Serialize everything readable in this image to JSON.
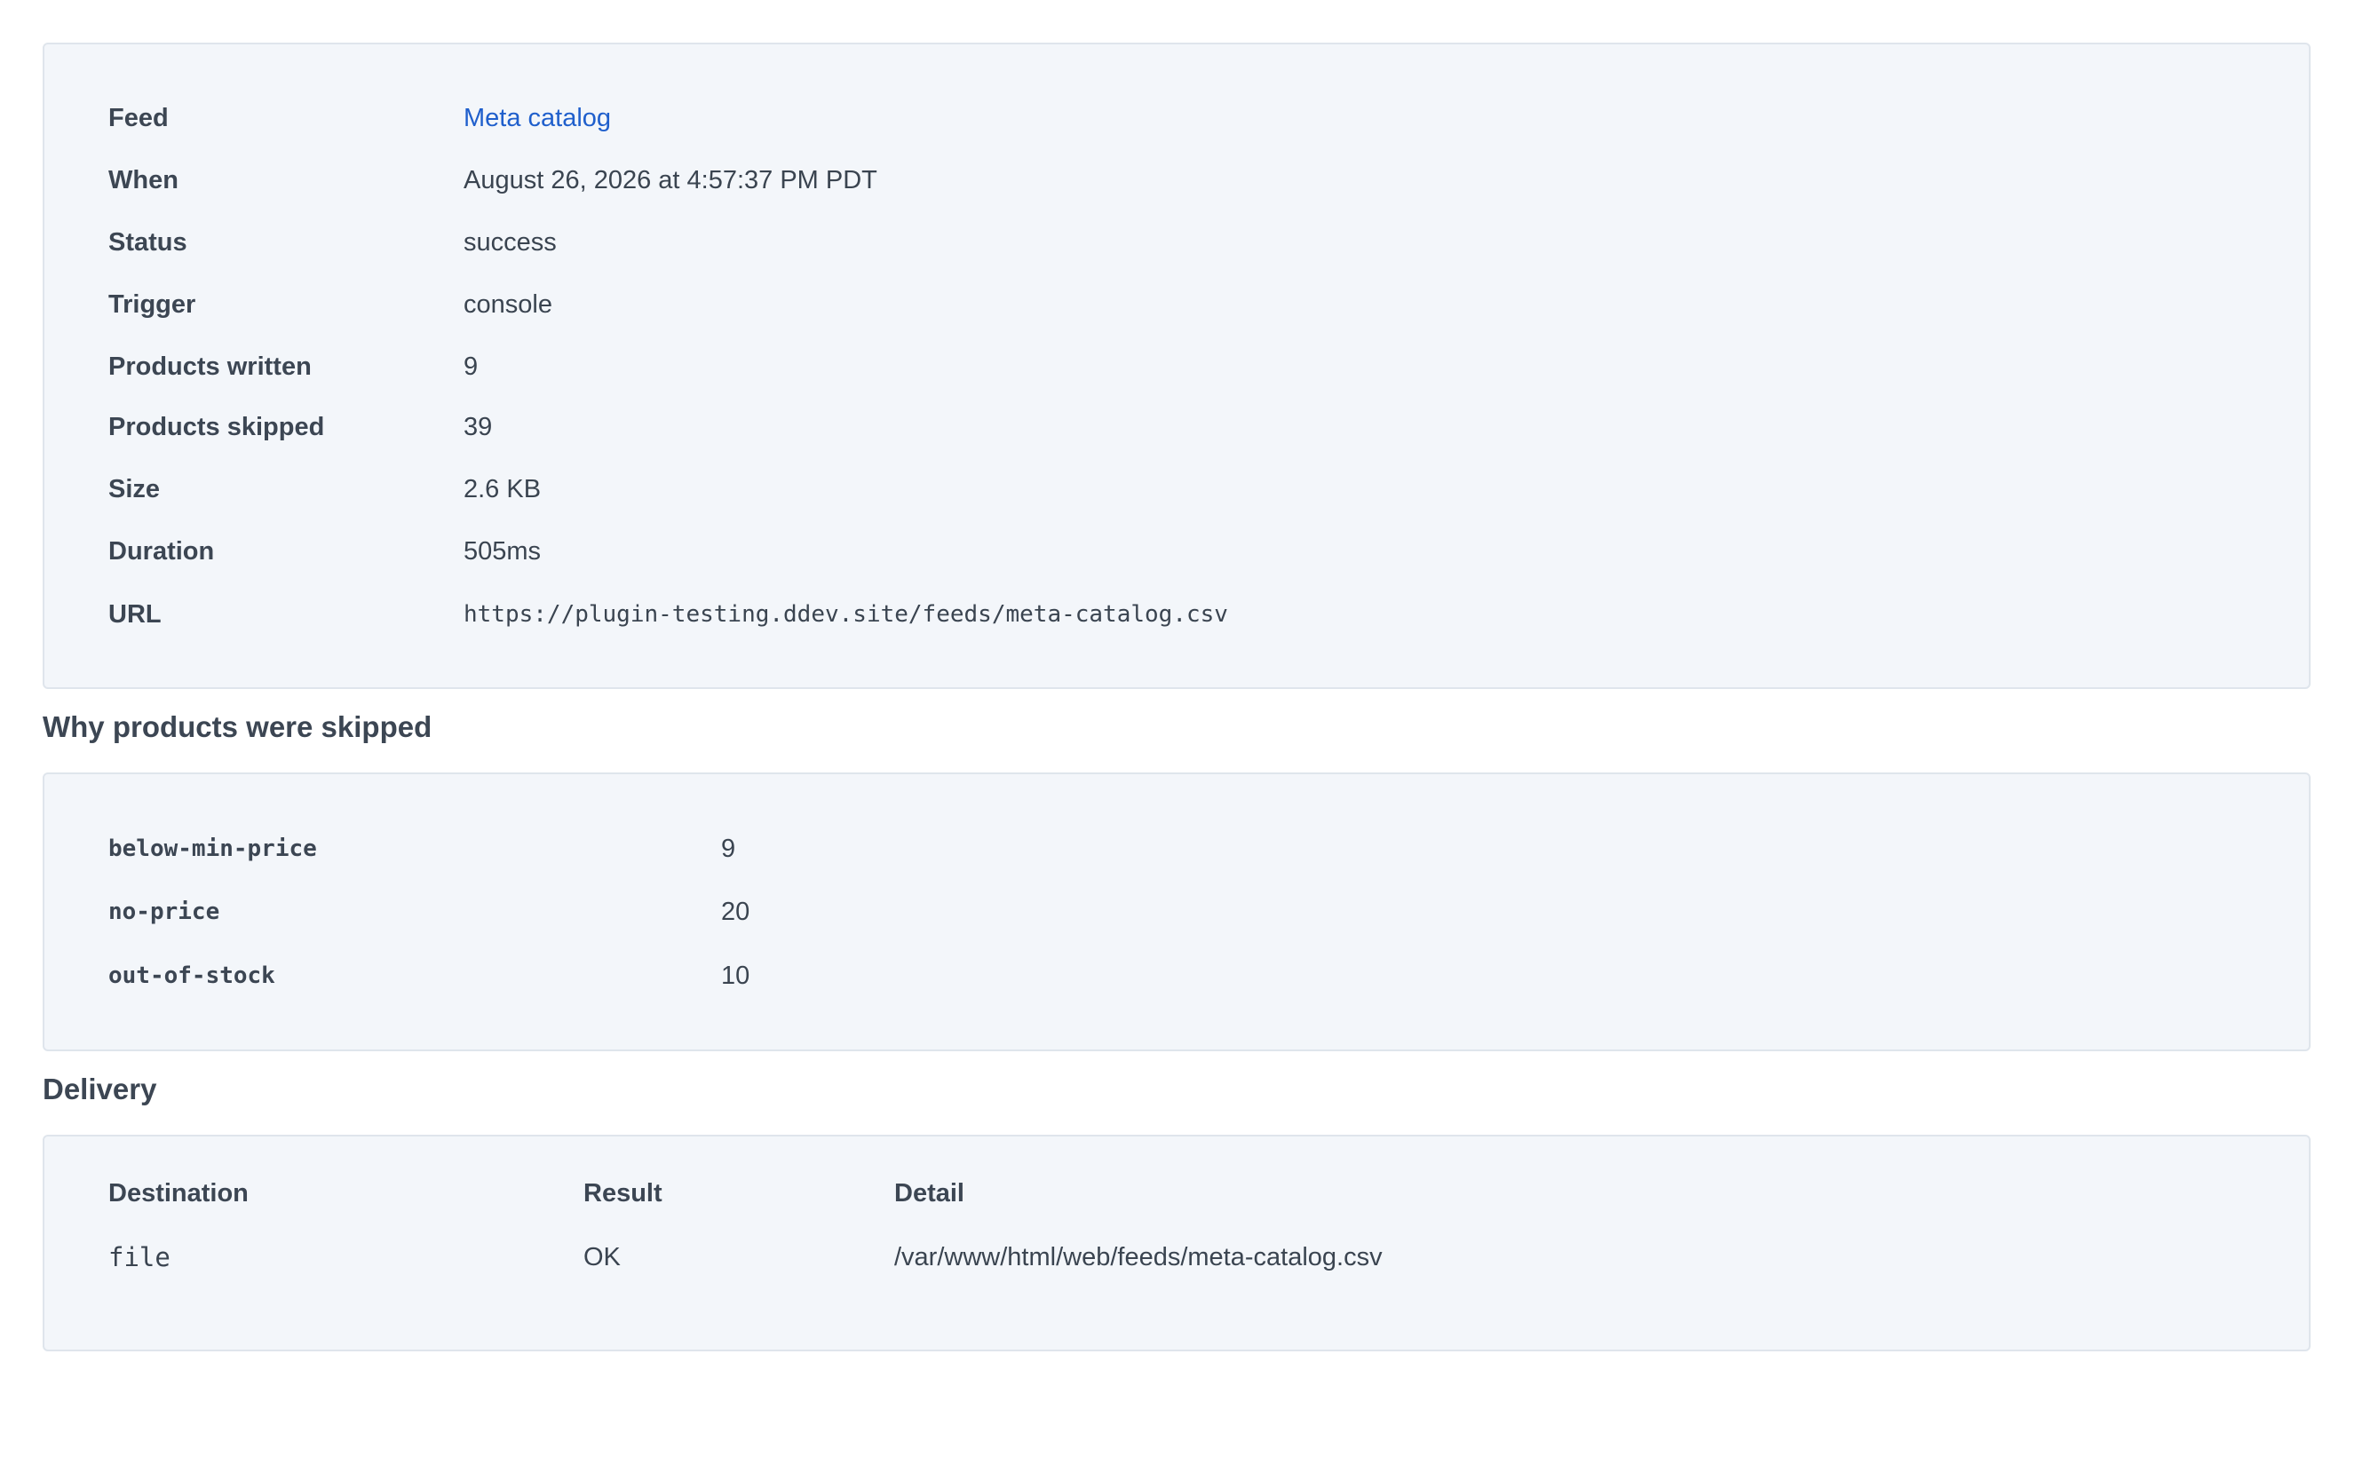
{
  "details": {
    "feed": {
      "label": "Feed",
      "value": "Meta catalog"
    },
    "when": {
      "label": "When",
      "value": "August 26, 2026 at 4:57:37 PM PDT"
    },
    "status": {
      "label": "Status",
      "value": "success"
    },
    "trigger": {
      "label": "Trigger",
      "value": "console"
    },
    "written": {
      "label": "Products written",
      "value": "9"
    },
    "skipped": {
      "label": "Products skipped",
      "value": "39"
    },
    "size": {
      "label": "Size",
      "value": "2.6 KB"
    },
    "duration": {
      "label": "Duration",
      "value": "505ms"
    },
    "url": {
      "label": "URL",
      "value": "https://plugin-testing.ddev.site/feeds/meta-catalog.csv"
    }
  },
  "skip_reasons": {
    "heading": "Why products were skipped",
    "items": [
      {
        "reason": "below-min-price",
        "count": "9"
      },
      {
        "reason": "no-price",
        "count": "20"
      },
      {
        "reason": "out-of-stock",
        "count": "10"
      }
    ]
  },
  "delivery": {
    "heading": "Delivery",
    "columns": {
      "destination": "Destination",
      "result": "Result",
      "detail": "Detail"
    },
    "rows": [
      {
        "destination": "file",
        "result": "OK",
        "detail": "/var/www/html/web/feeds/meta-catalog.csv"
      }
    ]
  },
  "colors": {
    "panel_bg": "#f3f6fa",
    "panel_border": "#dfe5ec",
    "link": "#1f5fcc",
    "text": "#3c4653"
  }
}
